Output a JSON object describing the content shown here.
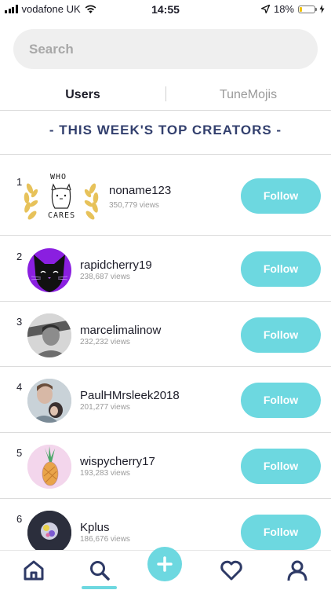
{
  "status_bar": {
    "carrier": "vodafone UK",
    "time": "14:55",
    "battery": "18%",
    "battery_level": 0.18
  },
  "search": {
    "placeholder": "Search"
  },
  "tabs": [
    {
      "label": "Users",
      "active": true
    },
    {
      "label": "TuneMojis",
      "active": false
    }
  ],
  "section_title": "- THIS WEEK'S TOP CREATORS -",
  "creators": [
    {
      "rank": "1",
      "name": "noname123",
      "views": "350,779 views",
      "action": "Follow",
      "avatar_text_top": "WHO",
      "avatar_text_bottom": "CARES"
    },
    {
      "rank": "2",
      "name": "rapidcherry19",
      "views": "238,687 views",
      "action": "Follow"
    },
    {
      "rank": "3",
      "name": "marcelimalinow",
      "views": "232,232 views",
      "action": "Follow"
    },
    {
      "rank": "4",
      "name": "PaulHMrsleek2018",
      "views": "201,277 views",
      "action": "Follow"
    },
    {
      "rank": "5",
      "name": "wispycherry17",
      "views": "193,283 views",
      "action": "Follow"
    },
    {
      "rank": "6",
      "name": "Kplus",
      "views": "186,676 views",
      "action": "Follow"
    }
  ],
  "nav": [
    {
      "icon": "home-icon",
      "active": false
    },
    {
      "icon": "search-icon",
      "active": true
    },
    {
      "icon": "plus-icon",
      "active": false
    },
    {
      "icon": "heart-icon",
      "active": false
    },
    {
      "icon": "profile-icon",
      "active": false
    }
  ],
  "colors": {
    "accent": "#6dd8e0",
    "title": "#33406e",
    "battery": "#f2c200"
  }
}
